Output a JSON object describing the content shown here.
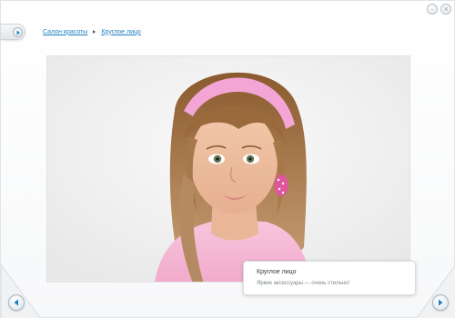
{
  "window": {
    "minimize_glyph": "–",
    "close_glyph": "×"
  },
  "breadcrumb": {
    "items": [
      {
        "label": "Салон красоты"
      },
      {
        "label": "Круглое лицо"
      }
    ]
  },
  "photo": {
    "subject": "girl-with-pink-headband"
  },
  "caption": {
    "title": "Круглое лицо",
    "subtitle": "Яркие аксессуары — очень стильно!"
  },
  "colors": {
    "link": "#1e7fc0",
    "nav_arrow": "#1e7fc0",
    "headband": "#f3a6d6",
    "earring": "#e0559e"
  },
  "icons": {
    "side_tab": "play-icon",
    "prev": "arrow-left-icon",
    "next": "arrow-right-icon"
  }
}
